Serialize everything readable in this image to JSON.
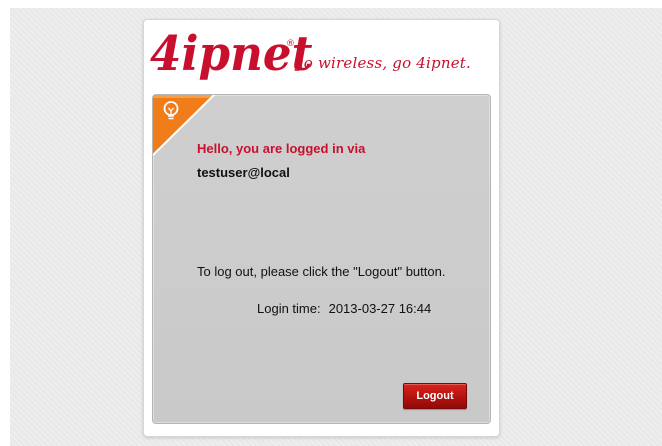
{
  "brand": {
    "logo_text": "4ipnet",
    "registered_mark": "®",
    "tagline": "go wireless, go 4ipnet.",
    "color": "#c8102e"
  },
  "panel": {
    "ribbon_color": "#f07d1a",
    "icon": "lightbulb-icon",
    "greeting": "Hello, you are logged in via",
    "username": "testuser@local",
    "logout_hint": "To log out, please click the \"Logout\" button.",
    "login_time_label": "Login time:",
    "login_time_value": "2013-03-27 16:44",
    "logout_button_label": "Logout"
  }
}
